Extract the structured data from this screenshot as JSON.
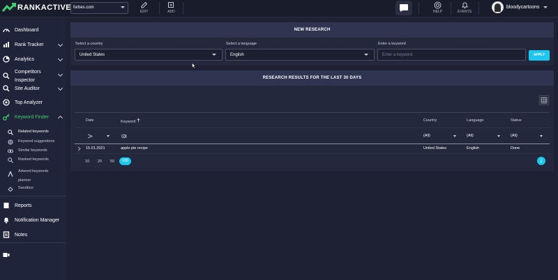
{
  "app": {
    "logo_text_a": "RANK",
    "logo_text_b": "ACTIVE"
  },
  "topbar": {
    "project": "forbes.com",
    "tools": [
      {
        "label": "EDIT"
      },
      {
        "label": "ADD"
      }
    ],
    "help_label": "HELP",
    "events_label": "EVENTS",
    "username": "bloodycartoons"
  },
  "sidebar": {
    "items": [
      {
        "label": "Dashboard"
      },
      {
        "label": "Rank Tracker"
      },
      {
        "label": "Analytics"
      },
      {
        "label": "Competitors\nInspector"
      },
      {
        "label": "Site Auditor"
      },
      {
        "label": "Top Analyzer"
      },
      {
        "label": "Keyword Finder"
      },
      {
        "label": "Reports"
      },
      {
        "label": "Notification Manager"
      },
      {
        "label": "Notes"
      }
    ],
    "sub_items": [
      {
        "label": "Related keywords"
      },
      {
        "label": "Keyword suggestions"
      },
      {
        "label": "Similar keywords"
      },
      {
        "label": "Ranked keywords"
      },
      {
        "label": "Adword keywords\nplanner"
      },
      {
        "label": "Sandbox"
      }
    ],
    "competitors_line1": "Competitors",
    "competitors_line2": "Inspector",
    "adword_line1": "Adword keywords",
    "adword_line2": "planner"
  },
  "new_research": {
    "title": "NEW RESEARCH",
    "country_label": "Select a country",
    "country_value": "United States",
    "language_label": "Select a language",
    "language_value": "English",
    "keyword_label": "Enter a keyword",
    "keyword_placeholder": "Enter a keyword",
    "apply_label": "APPLY"
  },
  "results": {
    "title": "RESEARCH RESULTS FOR THE LAST 30 DAYS",
    "columns": {
      "date": "Date",
      "keyword": "Keyword",
      "country": "Country",
      "language": "Language",
      "status": "Status"
    },
    "filters": {
      "country": "(All)",
      "language": "(All)",
      "status": "(All)"
    },
    "rows": [
      {
        "date": "15.01.2021",
        "keyword": "apple pie recipe",
        "country": "United States",
        "language": "English",
        "status": "Done"
      }
    ],
    "page_sizes": [
      "10",
      "20",
      "50",
      "100"
    ],
    "active_page_size": "100"
  }
}
